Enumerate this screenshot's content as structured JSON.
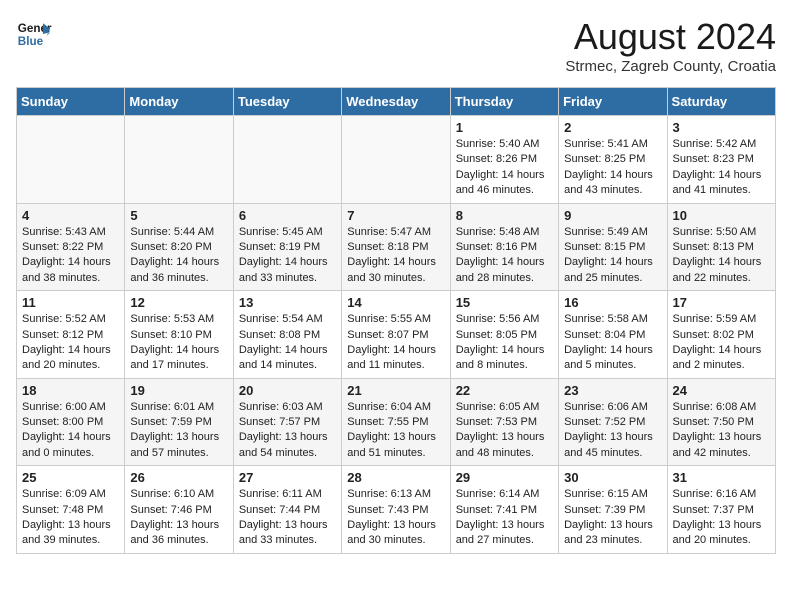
{
  "logo": {
    "line1": "General",
    "line2": "Blue"
  },
  "title": "August 2024",
  "location": "Strmec, Zagreb County, Croatia",
  "days_of_week": [
    "Sunday",
    "Monday",
    "Tuesday",
    "Wednesday",
    "Thursday",
    "Friday",
    "Saturday"
  ],
  "weeks": [
    [
      {
        "day": "",
        "info": ""
      },
      {
        "day": "",
        "info": ""
      },
      {
        "day": "",
        "info": ""
      },
      {
        "day": "",
        "info": ""
      },
      {
        "day": "1",
        "info": "Sunrise: 5:40 AM\nSunset: 8:26 PM\nDaylight: 14 hours and 46 minutes."
      },
      {
        "day": "2",
        "info": "Sunrise: 5:41 AM\nSunset: 8:25 PM\nDaylight: 14 hours and 43 minutes."
      },
      {
        "day": "3",
        "info": "Sunrise: 5:42 AM\nSunset: 8:23 PM\nDaylight: 14 hours and 41 minutes."
      }
    ],
    [
      {
        "day": "4",
        "info": "Sunrise: 5:43 AM\nSunset: 8:22 PM\nDaylight: 14 hours and 38 minutes."
      },
      {
        "day": "5",
        "info": "Sunrise: 5:44 AM\nSunset: 8:20 PM\nDaylight: 14 hours and 36 minutes."
      },
      {
        "day": "6",
        "info": "Sunrise: 5:45 AM\nSunset: 8:19 PM\nDaylight: 14 hours and 33 minutes."
      },
      {
        "day": "7",
        "info": "Sunrise: 5:47 AM\nSunset: 8:18 PM\nDaylight: 14 hours and 30 minutes."
      },
      {
        "day": "8",
        "info": "Sunrise: 5:48 AM\nSunset: 8:16 PM\nDaylight: 14 hours and 28 minutes."
      },
      {
        "day": "9",
        "info": "Sunrise: 5:49 AM\nSunset: 8:15 PM\nDaylight: 14 hours and 25 minutes."
      },
      {
        "day": "10",
        "info": "Sunrise: 5:50 AM\nSunset: 8:13 PM\nDaylight: 14 hours and 22 minutes."
      }
    ],
    [
      {
        "day": "11",
        "info": "Sunrise: 5:52 AM\nSunset: 8:12 PM\nDaylight: 14 hours and 20 minutes."
      },
      {
        "day": "12",
        "info": "Sunrise: 5:53 AM\nSunset: 8:10 PM\nDaylight: 14 hours and 17 minutes."
      },
      {
        "day": "13",
        "info": "Sunrise: 5:54 AM\nSunset: 8:08 PM\nDaylight: 14 hours and 14 minutes."
      },
      {
        "day": "14",
        "info": "Sunrise: 5:55 AM\nSunset: 8:07 PM\nDaylight: 14 hours and 11 minutes."
      },
      {
        "day": "15",
        "info": "Sunrise: 5:56 AM\nSunset: 8:05 PM\nDaylight: 14 hours and 8 minutes."
      },
      {
        "day": "16",
        "info": "Sunrise: 5:58 AM\nSunset: 8:04 PM\nDaylight: 14 hours and 5 minutes."
      },
      {
        "day": "17",
        "info": "Sunrise: 5:59 AM\nSunset: 8:02 PM\nDaylight: 14 hours and 2 minutes."
      }
    ],
    [
      {
        "day": "18",
        "info": "Sunrise: 6:00 AM\nSunset: 8:00 PM\nDaylight: 14 hours and 0 minutes."
      },
      {
        "day": "19",
        "info": "Sunrise: 6:01 AM\nSunset: 7:59 PM\nDaylight: 13 hours and 57 minutes."
      },
      {
        "day": "20",
        "info": "Sunrise: 6:03 AM\nSunset: 7:57 PM\nDaylight: 13 hours and 54 minutes."
      },
      {
        "day": "21",
        "info": "Sunrise: 6:04 AM\nSunset: 7:55 PM\nDaylight: 13 hours and 51 minutes."
      },
      {
        "day": "22",
        "info": "Sunrise: 6:05 AM\nSunset: 7:53 PM\nDaylight: 13 hours and 48 minutes."
      },
      {
        "day": "23",
        "info": "Sunrise: 6:06 AM\nSunset: 7:52 PM\nDaylight: 13 hours and 45 minutes."
      },
      {
        "day": "24",
        "info": "Sunrise: 6:08 AM\nSunset: 7:50 PM\nDaylight: 13 hours and 42 minutes."
      }
    ],
    [
      {
        "day": "25",
        "info": "Sunrise: 6:09 AM\nSunset: 7:48 PM\nDaylight: 13 hours and 39 minutes."
      },
      {
        "day": "26",
        "info": "Sunrise: 6:10 AM\nSunset: 7:46 PM\nDaylight: 13 hours and 36 minutes."
      },
      {
        "day": "27",
        "info": "Sunrise: 6:11 AM\nSunset: 7:44 PM\nDaylight: 13 hours and 33 minutes."
      },
      {
        "day": "28",
        "info": "Sunrise: 6:13 AM\nSunset: 7:43 PM\nDaylight: 13 hours and 30 minutes."
      },
      {
        "day": "29",
        "info": "Sunrise: 6:14 AM\nSunset: 7:41 PM\nDaylight: 13 hours and 27 minutes."
      },
      {
        "day": "30",
        "info": "Sunrise: 6:15 AM\nSunset: 7:39 PM\nDaylight: 13 hours and 23 minutes."
      },
      {
        "day": "31",
        "info": "Sunrise: 6:16 AM\nSunset: 7:37 PM\nDaylight: 13 hours and 20 minutes."
      }
    ]
  ]
}
